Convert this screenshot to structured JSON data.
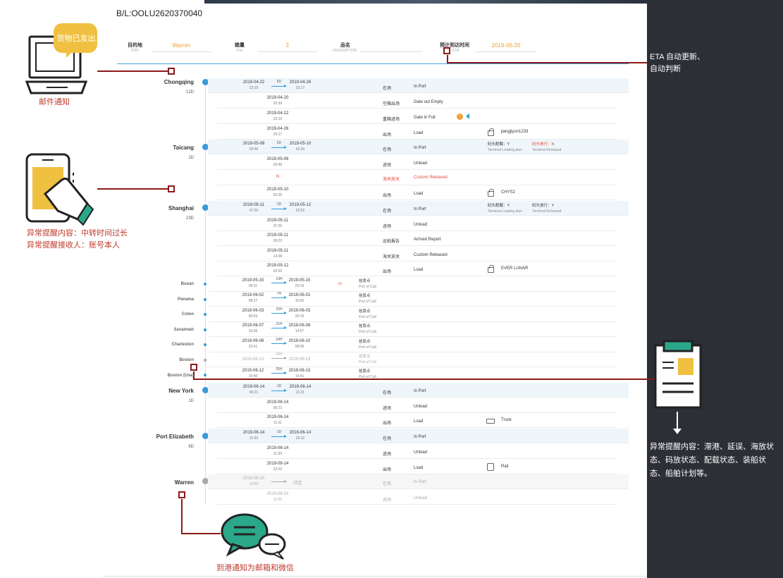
{
  "bl": "B/L:OOLU2620370040",
  "header": {
    "fields": [
      {
        "label": "目的地",
        "sub": "POD",
        "value": "Warren"
      },
      {
        "label": "箱量",
        "sub": "VOL",
        "value": "3"
      },
      {
        "label": "品名",
        "sub": "DESCRIPTION",
        "value": ""
      },
      {
        "label": "预计到达时间",
        "sub": "ETA",
        "value": "2019-06-20"
      }
    ]
  },
  "annotations": {
    "email_bubble": "货物已发出",
    "email_label": "邮件通知",
    "phone_line1": "异常提醒内容：中转时间过长",
    "phone_line2": "异常提醒接收人：账号本人",
    "chat_label": "到港通知为邮箱和微信",
    "eta_line1": "ETA 自动更新、",
    "eta_line2": "自动判断",
    "abn_text": "异常提醒内容：滞港、延误、海放状态、码放状态、配载状态、装船状态、船舶计划等。"
  },
  "ports": [
    {
      "name": "Chongqing",
      "days": "12D"
    },
    {
      "name": "Taicang",
      "days": "1D"
    },
    {
      "name": "Shanghai",
      "days": "23D"
    },
    {
      "name": "Busan"
    },
    {
      "name": "Panama"
    },
    {
      "name": "Colon"
    },
    {
      "name": "Savannah"
    },
    {
      "name": "Charleston"
    },
    {
      "name": "Boston"
    },
    {
      "name": "Boston (Usa)"
    },
    {
      "name": "New York",
      "days": "1D"
    },
    {
      "name": "Port Elizabeth",
      "days": "6D"
    },
    {
      "name": "Warren"
    }
  ],
  "rows": [
    {
      "d1": "2019-04-22",
      "t1": "23:10",
      "dur": "5D",
      "d2": "2019-04-26",
      "t2": "23:17",
      "cn": "在场",
      "en": "In Port"
    },
    {
      "d": "2019-04-20",
      "t": "22:39",
      "cn": "空箱出场",
      "en": "Gate out Empty"
    },
    {
      "d": "2019-04-22",
      "t": "23:10",
      "cn": "重箱进场",
      "en": "Gate in Full",
      "bell": "!"
    },
    {
      "d": "2019-04-26",
      "t": "23:17",
      "cn": "出场",
      "en": "Load",
      "info": "jiangjiyun1233"
    },
    {
      "d1": "2019-05-08",
      "t1": "02:46",
      "dur": "2D",
      "d2": "2019-05-10",
      "t2": "02:35",
      "cn": "在场",
      "en": "In Port",
      "x1": "码头配载：Y",
      "x1s": "Terminal Loading plan",
      "x2": "码头放行：N",
      "x2s": "Terminal Released"
    },
    {
      "d": "2019-05-08",
      "t": "02:46",
      "cn": "进场",
      "en": "Unload"
    },
    {
      "n": "N",
      "cn": "海关放关",
      "en": "Custom Released"
    },
    {
      "d": "2019-05-10",
      "t": "02:35",
      "cn": "出场",
      "en": "Load",
      "info": "CHYS2"
    },
    {
      "d1": "2019-05-11",
      "t1": "07:20",
      "dur": "1D",
      "d2": "2019-05-12",
      "t2": "02:02",
      "cn": "在场",
      "en": "In Port",
      "x1": "码头配载：Y",
      "x1s": "Terminal Loading plan",
      "x2": "码头放行：Y",
      "x2s": "Terminal Released"
    },
    {
      "d": "2019-05-11",
      "t": "07:20",
      "cn": "进场",
      "en": "Unload"
    },
    {
      "d": "2019-05-11",
      "t": "09:23",
      "cn": "运抵报告",
      "en": "Arrived Report"
    },
    {
      "d": "2019-05-11",
      "t": "14:38",
      "cn": "海关放关",
      "en": "Custom Released"
    },
    {
      "d": "2019-05-12",
      "t": "02:02",
      "cn": "出场",
      "en": "Load",
      "info": "EVER LUNAR"
    },
    {
      "d1": "2019-05-15",
      "t1": "04:11",
      "dur": "19H",
      "d2": "2019-05-15",
      "t2": "23:19",
      "plus": "+3",
      "cn": "挂靠点",
      "en": "Port of Call"
    },
    {
      "d1": "2019-06-02",
      "t1": "08:27",
      "dur": "7H",
      "d2": "2019-06-02",
      "t2": "15:05",
      "cn": "挂靠点",
      "en": "Port of Call"
    },
    {
      "d1": "2019-06-03",
      "t1": "06:03",
      "dur": "15H",
      "d2": "2019-06-03",
      "t2": "20:15",
      "cn": "挂靠点",
      "en": "Port of Call"
    },
    {
      "d1": "2019-06-07",
      "t1": "16:36",
      "dur": "21H",
      "d2": "2019-06-08",
      "t2": "14:57",
      "cn": "挂靠点",
      "en": "Port of Call"
    },
    {
      "d1": "2019-06-08",
      "t1": "22:41",
      "dur": "24H",
      "d2": "2019-06-10",
      "t2": "08:06",
      "cn": "挂靠点",
      "en": "Port of Call"
    },
    {
      "d1": "2019-06-12",
      "t1": "",
      "dur": "24H",
      "d2": "2019-06-13",
      "t2": "",
      "cn": "挂靠点",
      "en": "Port of Call"
    },
    {
      "d1": "2019-06-12",
      "t1": "15:40",
      "dur": "25H",
      "d2": "2019-06-13",
      "t2": "16:41",
      "cn": "挂靠点",
      "en": "Port of Call"
    },
    {
      "d1": "2019-06-14",
      "t1": "06:21",
      "dur": "1D",
      "d2": "2019-06-14",
      "t2": "11:31",
      "cn": "在场",
      "en": "In Port"
    },
    {
      "d": "2019-06-14",
      "t": "06:21",
      "cn": "进场",
      "en": "Unload"
    },
    {
      "d": "2019-06-14",
      "t": "11:31",
      "cn": "出场",
      "en": "Load",
      "info": "Truck"
    },
    {
      "d1": "2019-06-14",
      "t1": "11:33",
      "dur": "1D",
      "d2": "2019-06-14",
      "t2": "22:32",
      "cn": "在场",
      "en": "In Port"
    },
    {
      "d": "2019-06-14",
      "t": "11:33",
      "cn": "进场",
      "en": "Unload"
    },
    {
      "d": "2019-06-14",
      "t": "22:32",
      "cn": "出场",
      "en": "Load",
      "info": "Rail"
    },
    {
      "d1": "2019-06-20",
      "t1": "12:00",
      "d2": "待定",
      "cn": "在场",
      "en": "In Port"
    },
    {
      "d": "2019-06-20",
      "t": "12:00",
      "cn": "进场",
      "en": "Unload"
    }
  ]
}
